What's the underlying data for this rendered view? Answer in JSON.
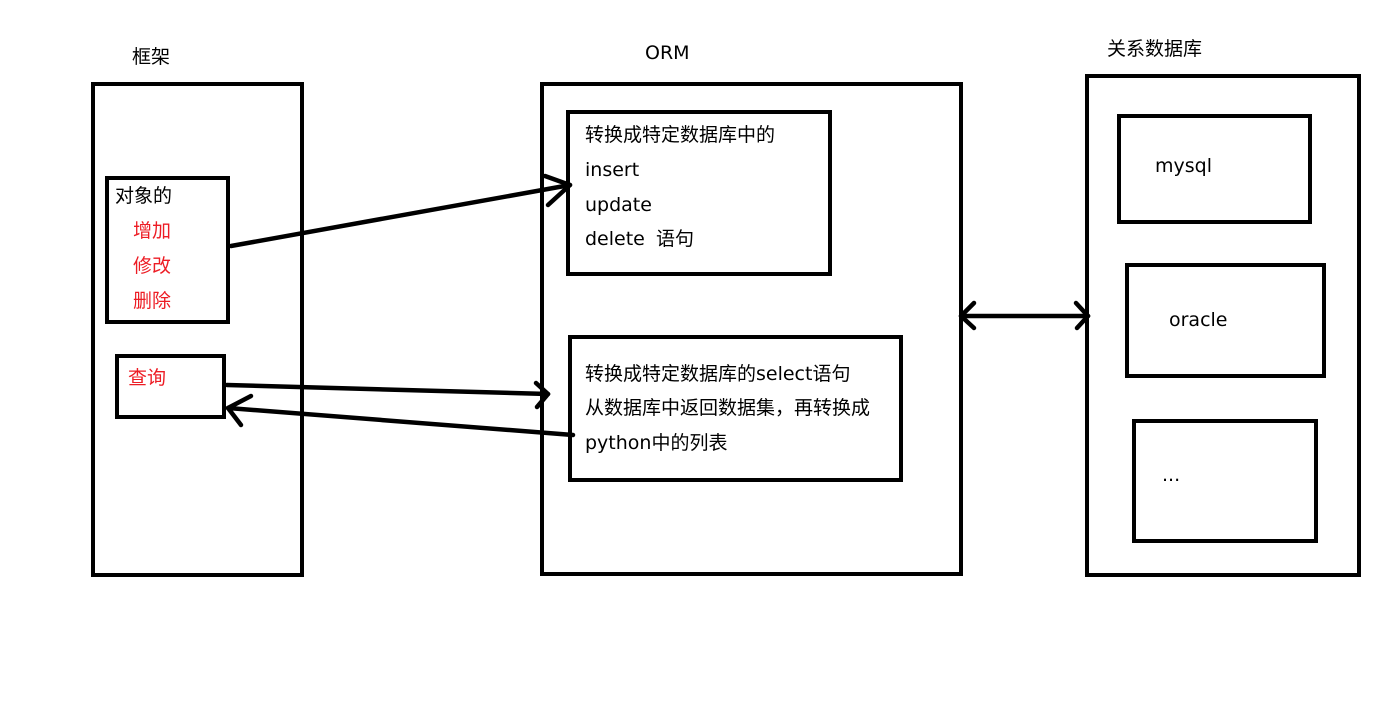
{
  "diagram": {
    "framework": {
      "title": "框架",
      "crud_box": {
        "heading": "对象的",
        "items": [
          "增加",
          "修改",
          "删除"
        ]
      },
      "query_box": {
        "label": "查询"
      }
    },
    "orm": {
      "title": "ORM",
      "write_box": {
        "lines": [
          "转换成特定数据库中的",
          "insert",
          "update",
          "delete"
        ],
        "suffix": "语句"
      },
      "read_box": {
        "lines": [
          "转换成特定数据库的select语句",
          "从数据库中返回数据集，再转换成",
          "python中的列表"
        ]
      }
    },
    "database": {
      "title": "关系数据库",
      "items": [
        "mysql",
        "oracle",
        "..."
      ]
    },
    "colors": {
      "stroke": "#000000",
      "highlight_text": "#ED1C24",
      "text": "#000000",
      "background": "#FFFFFF"
    },
    "connections": [
      {
        "from": "crud_box",
        "to": "write_box",
        "direction": "forward"
      },
      {
        "from": "query_box",
        "to": "read_box",
        "direction": "forward"
      },
      {
        "from": "read_box",
        "to": "query_box",
        "direction": "forward"
      },
      {
        "from": "orm",
        "to": "database",
        "direction": "both"
      }
    ]
  }
}
